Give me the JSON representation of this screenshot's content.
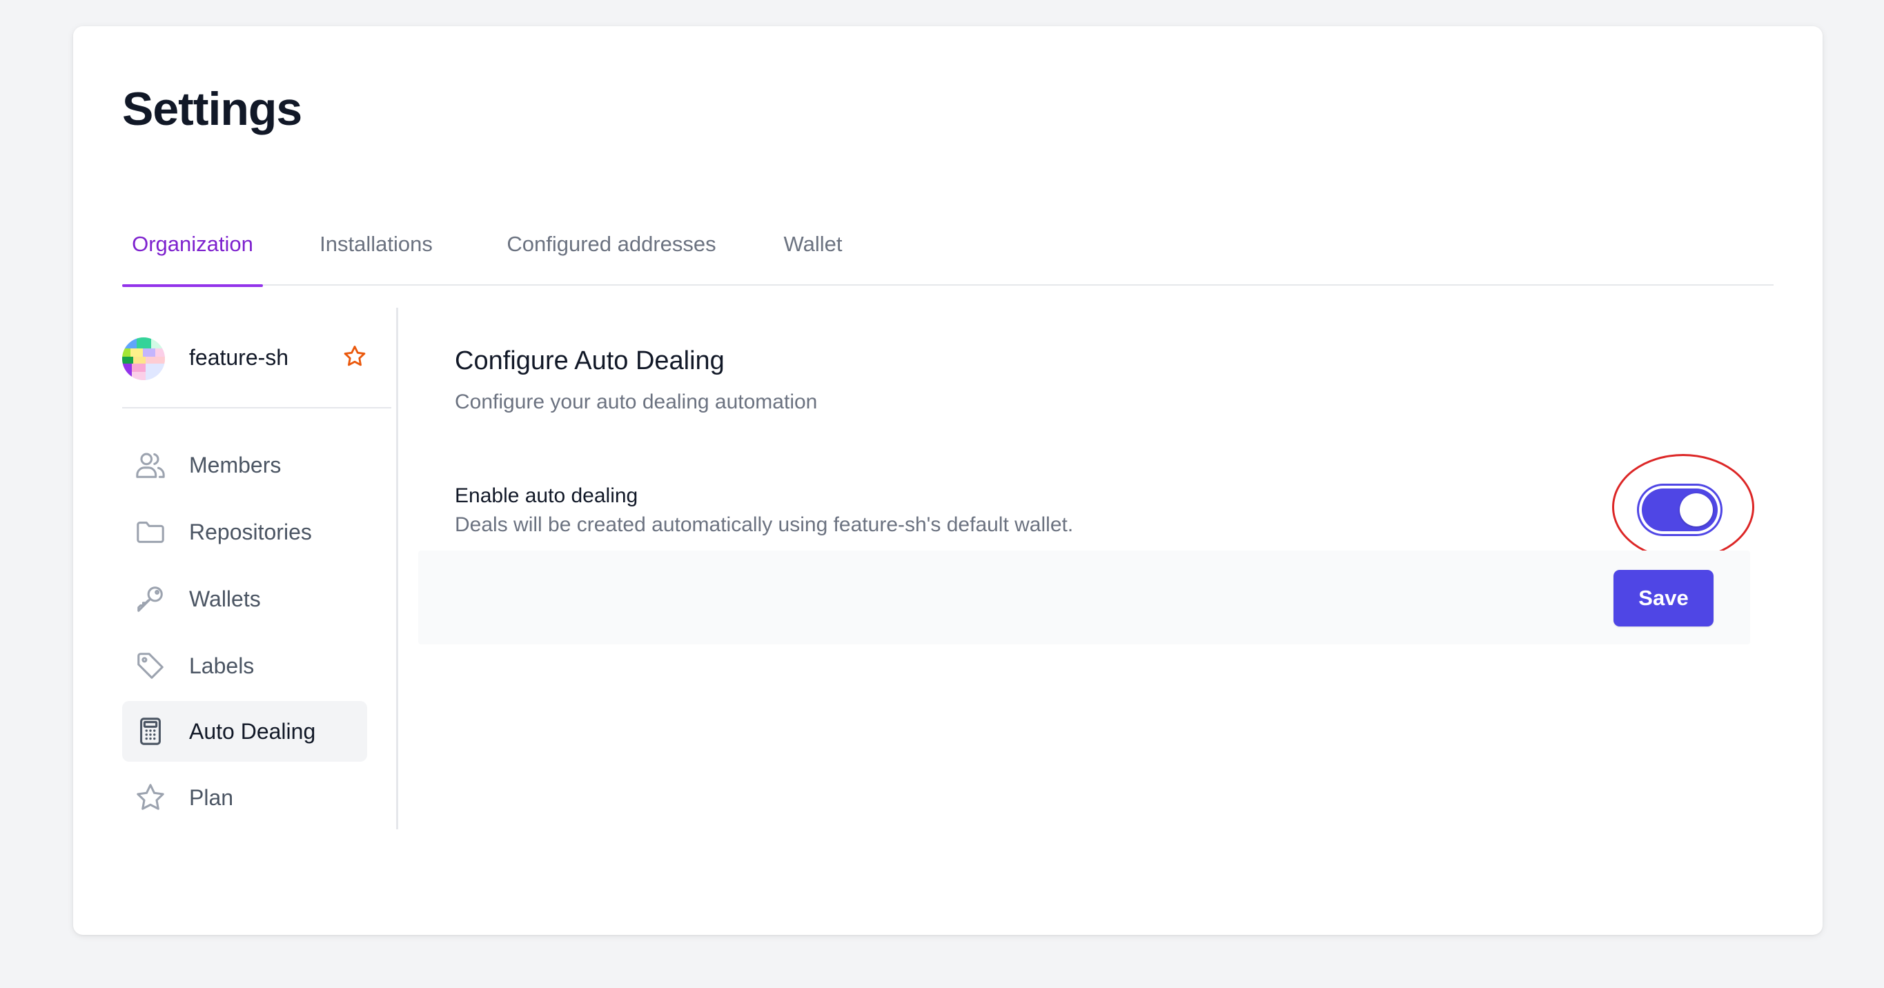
{
  "page": {
    "title": "Settings"
  },
  "tabs": [
    {
      "label": "Organization",
      "active": true
    },
    {
      "label": "Installations",
      "active": false
    },
    {
      "label": "Configured addresses",
      "active": false
    },
    {
      "label": "Wallet",
      "active": false
    }
  ],
  "org": {
    "name": "feature-sh",
    "avatar_icon": "org-avatar-icon",
    "star_icon": "star-outline-icon",
    "star_color": "#ea580c"
  },
  "sidebar": {
    "items": [
      {
        "label": "Members",
        "icon": "users-icon",
        "active": false
      },
      {
        "label": "Repositories",
        "icon": "folder-icon",
        "active": false
      },
      {
        "label": "Wallets",
        "icon": "key-icon",
        "active": false
      },
      {
        "label": "Labels",
        "icon": "tag-icon",
        "active": false
      },
      {
        "label": "Auto Dealing",
        "icon": "calculator-icon",
        "active": true
      },
      {
        "label": "Plan",
        "icon": "star-icon",
        "active": false
      }
    ]
  },
  "main": {
    "title": "Configure Auto Dealing",
    "subtitle": "Configure your auto dealing automation",
    "option": {
      "label": "Enable auto dealing",
      "description": "Deals will be created automatically using feature-sh's default wallet.",
      "enabled": true
    },
    "save_label": "Save"
  },
  "colors": {
    "accent": "#4f46e5",
    "tab_active": "#9333ea",
    "highlight": "#dc2626"
  }
}
